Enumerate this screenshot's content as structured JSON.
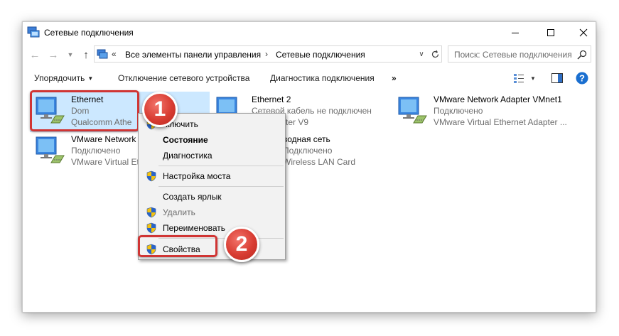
{
  "window": {
    "title": "Сетевые подключения"
  },
  "address": {
    "overflow": "«",
    "segments": [
      "Все элементы панели управления",
      "Сетевые подключения"
    ],
    "separator": "›",
    "search_placeholder": "Поиск: Сетевые подключения"
  },
  "toolbar": {
    "organize": "Упорядочить",
    "disable_device": "Отключение сетевого устройства",
    "diagnose": "Диагностика подключения",
    "more": "»"
  },
  "connections": [
    {
      "name": "Ethernet",
      "status": "Dom",
      "adapter": "Qualcomm Athe"
    },
    {
      "name": "Ethernet 2",
      "status": "Сетевой кабель не подключен",
      "adapter": "ear Adapter V9"
    },
    {
      "name": "VMware Network Adapter VMnet1",
      "status": "Подключено",
      "adapter": "VMware Virtual Ethernet Adapter ..."
    },
    {
      "name": "VMware Network",
      "status": "Подключено",
      "adapter": "VMware Virtual Et"
    },
    {
      "name": "водная сеть",
      "status": "Подключено",
      "adapter": "Wireless LAN Card"
    }
  ],
  "context_menu": {
    "items": [
      {
        "label": "Отключить",
        "visible_text": "ключить"
      },
      {
        "label": "Состояние"
      },
      {
        "label": "Диагностика"
      },
      {
        "label": "Настройка моста"
      },
      {
        "label": "Создать ярлык"
      },
      {
        "label": "Удалить"
      },
      {
        "label": "Переименовать"
      },
      {
        "label": "Свойства"
      }
    ]
  },
  "callouts": [
    "1",
    "2"
  ],
  "colors": {
    "selection": "#cce8ff",
    "highlight_frame": "#d03534",
    "badge": "#d83c32",
    "help": "#1a6fd0"
  }
}
